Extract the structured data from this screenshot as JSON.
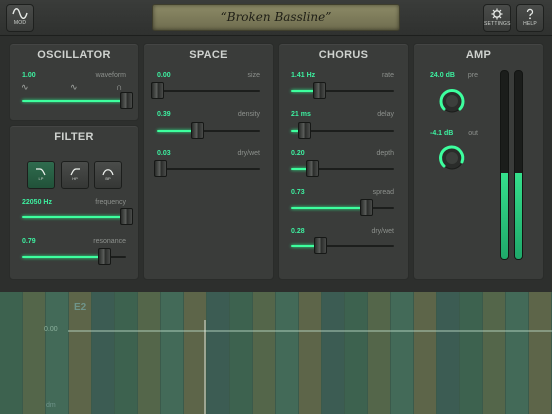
{
  "topbar": {
    "mod_label": "MOD",
    "preset_name": "“Broken Bassline”",
    "settings_label": "SETTINGS",
    "help_label": "HELP"
  },
  "oscillator": {
    "title": "OSCILLATOR",
    "value": "1.00",
    "label": "waveform",
    "level": 1.0
  },
  "filter": {
    "title": "FILTER",
    "types": [
      "LP",
      "HP",
      "BP"
    ],
    "active": "LP",
    "frequency": {
      "value": "22050 Hz",
      "label": "frequency",
      "level": 1.0
    },
    "resonance": {
      "value": "0.79",
      "label": "resonance",
      "level": 0.79
    }
  },
  "space": {
    "title": "SPACE",
    "params": [
      {
        "value": "0.00",
        "label": "size",
        "level": 0.0
      },
      {
        "value": "0.39",
        "label": "density",
        "level": 0.39
      },
      {
        "value": "0.03",
        "label": "dry/wet",
        "level": 0.03
      }
    ]
  },
  "chorus": {
    "title": "CHORUS",
    "params": [
      {
        "value": "1.41 Hz",
        "label": "rate",
        "level": 0.27
      },
      {
        "value": "21 ms",
        "label": "delay",
        "level": 0.13
      },
      {
        "value": "0.20",
        "label": "depth",
        "level": 0.2
      },
      {
        "value": "0.73",
        "label": "spread",
        "level": 0.73
      },
      {
        "value": "0.28",
        "label": "dry/wet",
        "level": 0.28
      }
    ]
  },
  "amp": {
    "title": "AMP",
    "pre": {
      "value": "24.0 dB",
      "label": "pre"
    },
    "out": {
      "value": "-4.1 dB",
      "label": "out"
    },
    "meters": [
      0.46,
      0.46
    ]
  },
  "keyboard": {
    "note": "E2",
    "value": "0.00",
    "unit": "dm"
  },
  "colors": {
    "accent": "#3dff9e",
    "panel": "#3a3c3a",
    "preset_display": "#7e7c5a"
  },
  "icons": [
    "waveform-icon",
    "gear-icon",
    "help-icon",
    "lowpass-icon",
    "highpass-icon",
    "bandpass-icon"
  ]
}
